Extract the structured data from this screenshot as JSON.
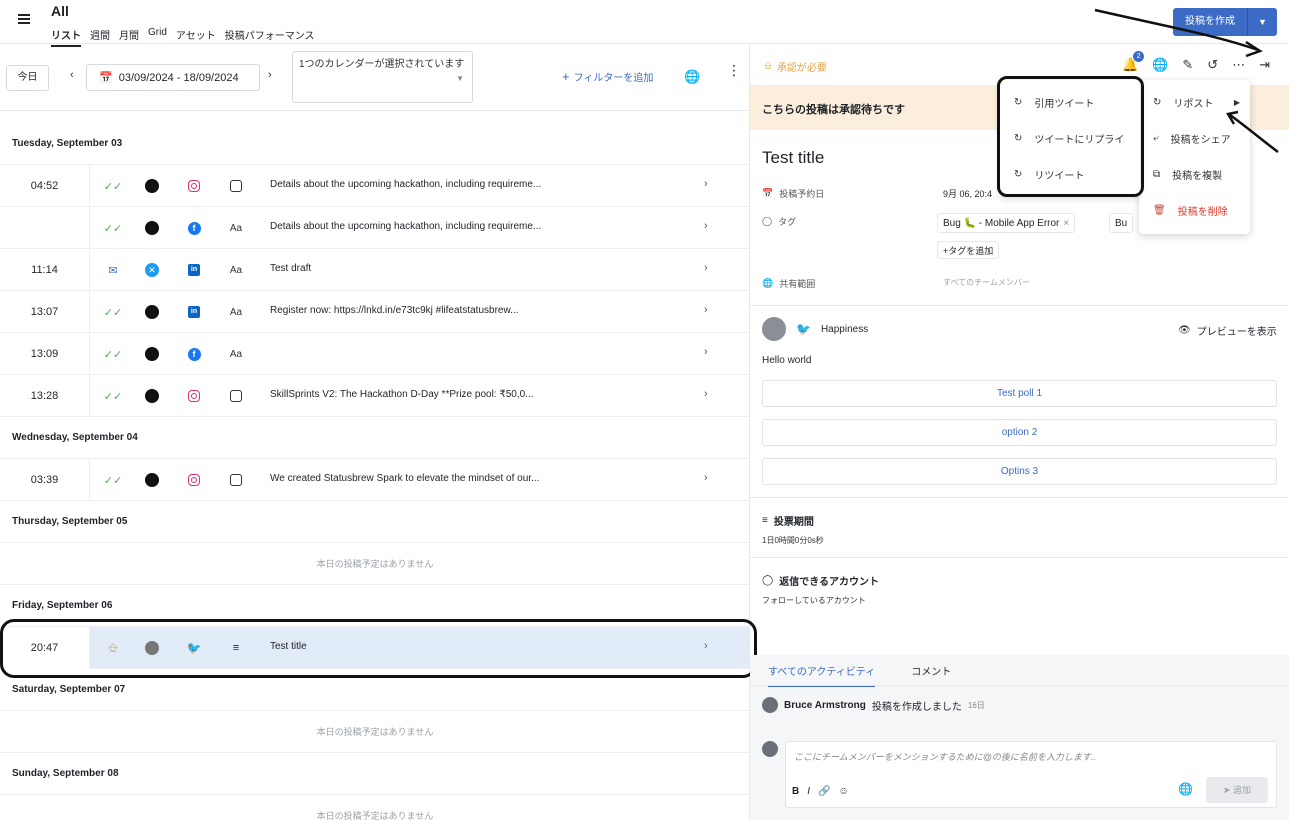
{
  "header": {
    "title": "All",
    "tabs": [
      "リスト",
      "週間",
      "月間",
      "Grid",
      "アセット",
      "投稿パフォーマンス"
    ],
    "create_button": "投稿を作成"
  },
  "toolbar": {
    "today": "今日",
    "date_range": "03/09/2024 - 18/09/2024",
    "calendar_select": "1つのカレンダーが選択されています",
    "add_filter": "フィルターを追加"
  },
  "days": [
    {
      "label": "Tuesday, September 03"
    },
    {
      "label": "Wednesday, September 04"
    },
    {
      "label": "Thursday, September 05"
    },
    {
      "label": "Friday, September 06"
    },
    {
      "label": "Saturday, September 07"
    },
    {
      "label": "Sunday, September 08"
    }
  ],
  "posts": [
    {
      "time": "04:52",
      "text": "Details about the upcoming hackathon, including requireme..."
    },
    {
      "time": "",
      "text": "Details about the upcoming hackathon, including requireme..."
    },
    {
      "time": "11:14",
      "text": "Test draft"
    },
    {
      "time": "13:07",
      "text": "Register now: https://lnkd.in/e73tc9kj #lifeatstatusbrew..."
    },
    {
      "time": "13:09",
      "text": ""
    },
    {
      "time": "13:28",
      "text": "SkillSprints V2: The Hackathon D-Day **Prize pool: ₹50,0..."
    },
    {
      "time": "03:39",
      "text": "We created Statusbrew Spark to elevate the mindset of our..."
    },
    {
      "time": "20:47",
      "text": "Test title"
    }
  ],
  "empty_day_text": "本日の投稿予定はありません",
  "detail": {
    "approval_badge": "承認が必要",
    "notification_count": "2",
    "pending_banner": "こちらの投稿は承認待ちです",
    "title": "Test title",
    "scheduled_label": "投稿予約日",
    "scheduled_value": "9月 06, 20:4",
    "tags_label": "タグ",
    "tag1": "Bug 🐛 - Mobile App Error",
    "tag2": "Bu",
    "add_tag": "+タグを追加",
    "scope_label": "共有範囲",
    "scope_value": "すべてのチームメンバー",
    "account_name": "Happiness",
    "preview": "プレビューを表示",
    "body": "Hello world",
    "poll_options": [
      "Test poll 1",
      "option 2",
      "Optins 3"
    ],
    "poll_period_title": "投票期間",
    "poll_period_value": "1日0時間0分0s秒",
    "reply_title": "返信できるアカウント",
    "reply_value": "フォローしているアカウント"
  },
  "activity": {
    "tabs": [
      "すべてのアクティビティ",
      "コメント"
    ],
    "entry_user": "Bruce Armstrong",
    "entry_text": "投稿を作成しました",
    "entry_time": "16日",
    "comment_placeholder": "ここにチームメンバーをメンションするために@の後に名前を入力します..",
    "send": "追加"
  },
  "more_menu": {
    "items": [
      "リポスト",
      "投稿をシェア",
      "投稿を複製",
      "投稿を削除"
    ]
  },
  "repost_menu": {
    "items": [
      "引用ツイート",
      "ツイートにリプライ",
      "リツイート"
    ]
  },
  "colors": {
    "accent": "#3b6bc4",
    "approval": "#e3a34a",
    "banner": "#fbeedd",
    "danger": "#d9392b",
    "selected_row": "#e1ecf8"
  }
}
